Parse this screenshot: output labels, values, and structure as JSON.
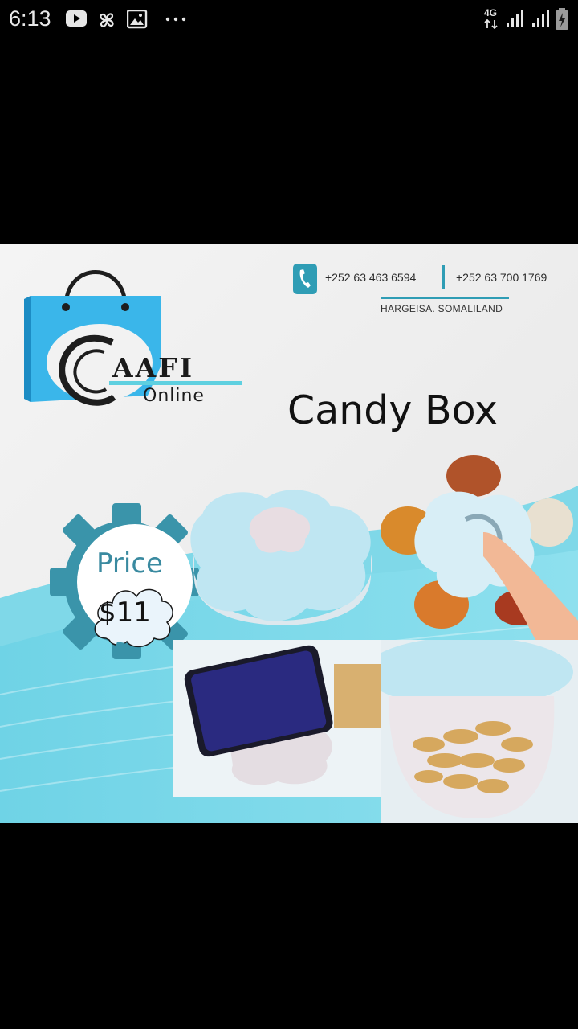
{
  "status_bar": {
    "time": "6:13",
    "network": "4G",
    "left_icons": [
      "youtube-icon",
      "fan-icon",
      "image-icon",
      "more-icon"
    ],
    "right_icons": [
      "signal-icon",
      "signal-icon",
      "battery-icon"
    ]
  },
  "ad": {
    "brand": {
      "name": "AAFI",
      "sub": "Online"
    },
    "contact": {
      "phone_1": "+252 63 463 6594",
      "phone_2": "+252 63 700 1769",
      "location": "HARGEISA. SOMALILAND"
    },
    "product_title": "Candy Box",
    "price": {
      "label": "Price",
      "value": "$11"
    },
    "colors": {
      "teal": "#3aa8c0",
      "light_teal": "#6fd3e6",
      "logo_blue": "#2fb0e8"
    }
  }
}
